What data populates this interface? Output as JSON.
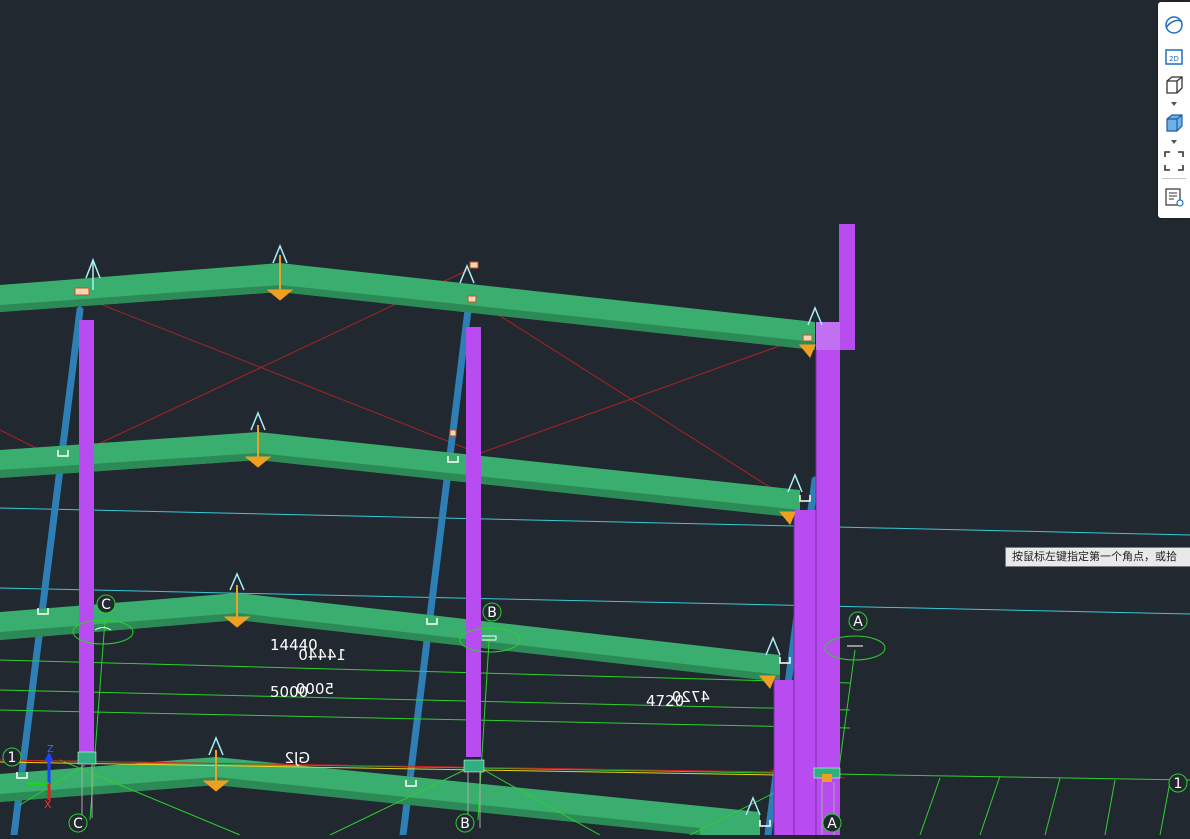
{
  "viewport": {
    "background": "#212830",
    "dimensions": [
      {
        "id": "dim-14440",
        "text": "14440"
      },
      {
        "id": "dim-14440-mirror",
        "text": "14440"
      },
      {
        "id": "dim-5000",
        "text": "5000"
      },
      {
        "id": "dim-5000-mirror",
        "text": "5000"
      },
      {
        "id": "dim-4720",
        "text": "4720"
      },
      {
        "id": "dim-4720-mirror",
        "text": "4720"
      },
      {
        "id": "label-gj2",
        "text": "GJ2"
      }
    ],
    "grid_bubbles": [
      {
        "id": "grid-c-top",
        "text": "C"
      },
      {
        "id": "grid-b-top",
        "text": "B"
      },
      {
        "id": "grid-a-top",
        "text": "A"
      },
      {
        "id": "grid-c-bottom",
        "text": "C"
      },
      {
        "id": "grid-b-bottom",
        "text": "B"
      },
      {
        "id": "grid-a-bottom",
        "text": "A"
      },
      {
        "id": "grid-1-left",
        "text": "1"
      },
      {
        "id": "grid-1-right",
        "text": "1"
      }
    ],
    "ucs": {
      "x_label": "X",
      "z_label": "Z"
    },
    "colors": {
      "beam": "#3aae6f",
      "beam_dark": "#2b8a55",
      "column_magenta": "#b84cf0",
      "column_blue": "#2e7fb5",
      "brace_red": "#a82424",
      "gridline_green": "#2fd02f",
      "axis_cyan": "#38c8d8",
      "load_orange": "#f0a020"
    }
  },
  "toolbar": {
    "buttons": [
      {
        "id": "orbit",
        "icon": "orbit-icon"
      },
      {
        "id": "2d",
        "icon": "view-2d-icon",
        "label": "2D"
      },
      {
        "id": "view-cube",
        "icon": "wireframe-cube-icon"
      },
      {
        "id": "visual-style",
        "icon": "shaded-cube-icon"
      },
      {
        "id": "zoom-extents",
        "icon": "zoom-extents-icon"
      },
      {
        "id": "properties",
        "icon": "list-view-icon"
      }
    ]
  },
  "tooltip": {
    "text": "按鼠标左键指定第一个角点，或拾"
  }
}
